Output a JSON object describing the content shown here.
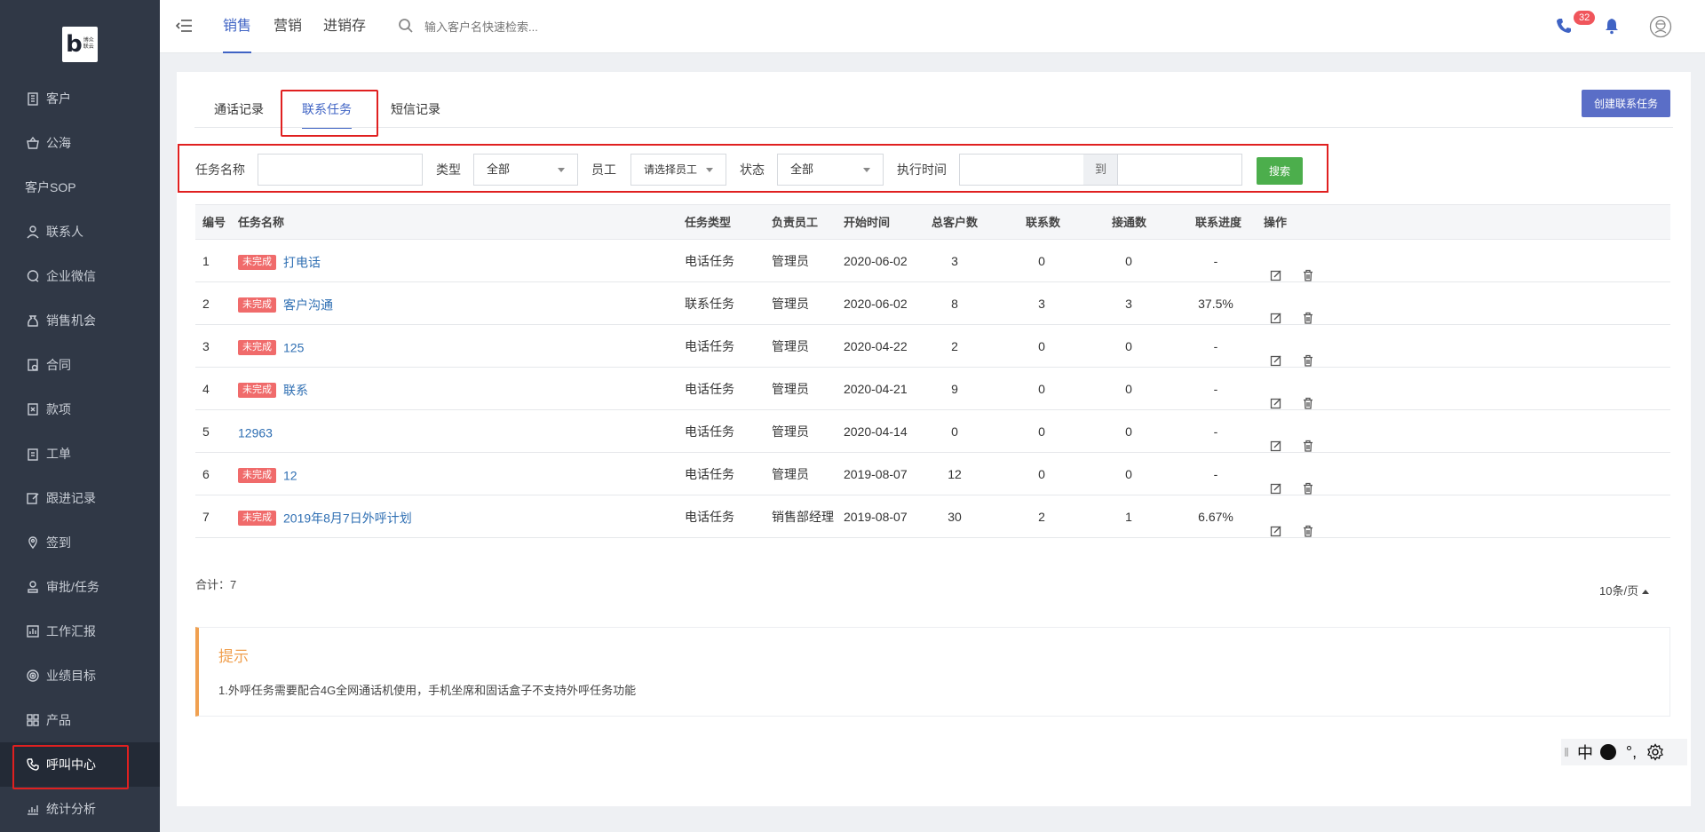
{
  "logo": {
    "letter": "b",
    "text_line1": "博众",
    "text_line2": "联云"
  },
  "sidebar": {
    "items": [
      {
        "label": "客户",
        "icon": "building-icon"
      },
      {
        "label": "公海",
        "icon": "basket-icon"
      },
      {
        "label": "客户SOP",
        "icon": "sop-icon",
        "prefix": "SOP"
      },
      {
        "label": "联系人",
        "icon": "person-icon"
      },
      {
        "label": "企业微信",
        "icon": "chat-icon"
      },
      {
        "label": "销售机会",
        "icon": "moneybag-icon"
      },
      {
        "label": "合同",
        "icon": "contract-icon"
      },
      {
        "label": "款项",
        "icon": "payment-icon"
      },
      {
        "label": "工单",
        "icon": "clipboard-icon"
      },
      {
        "label": "跟进记录",
        "icon": "edit-icon"
      },
      {
        "label": "签到",
        "icon": "location-icon"
      },
      {
        "label": "审批/任务",
        "icon": "approval-icon"
      },
      {
        "label": "工作汇报",
        "icon": "report-icon"
      },
      {
        "label": "业绩目标",
        "icon": "target-icon"
      },
      {
        "label": "产品",
        "icon": "grid-icon"
      },
      {
        "label": "呼叫中心",
        "icon": "phone-icon",
        "active": true
      },
      {
        "label": "统计分析",
        "icon": "chart-icon"
      }
    ]
  },
  "header": {
    "tabs": [
      "销售",
      "营销",
      "进销存"
    ],
    "active_tab": "销售",
    "search_placeholder": "输入客户名快速检索...",
    "notification_count": "32"
  },
  "subtabs": [
    "通话记录",
    "联系任务",
    "短信记录"
  ],
  "active_subtab": "联系任务",
  "create_button": "创建联系任务",
  "filters": {
    "task_name_label": "任务名称",
    "task_name_value": "",
    "type_label": "类型",
    "type_value": "全部",
    "employee_label": "员工",
    "employee_value": "请选择员工",
    "status_label": "状态",
    "status_value": "全部",
    "time_label": "执行时间",
    "time_sep": "到",
    "search_button": "搜索"
  },
  "table": {
    "columns": [
      "编号",
      "任务名称",
      "任务类型",
      "负责员工",
      "开始时间",
      "总客户数",
      "联系数",
      "接通数",
      "联系进度",
      "操作"
    ],
    "status_label": "未完成",
    "rows": [
      {
        "no": "1",
        "status": "未完成",
        "name": "打电话",
        "type": "电话任务",
        "owner": "管理员",
        "start": "2020-06-02",
        "total": "3",
        "contacted": "0",
        "connected": "0",
        "progress": "-"
      },
      {
        "no": "2",
        "status": "未完成",
        "name": "客户沟通",
        "type": "联系任务",
        "owner": "管理员",
        "start": "2020-06-02",
        "total": "8",
        "contacted": "3",
        "connected": "3",
        "progress": "37.5%"
      },
      {
        "no": "3",
        "status": "未完成",
        "name": "125",
        "type": "电话任务",
        "owner": "管理员",
        "start": "2020-04-22",
        "total": "2",
        "contacted": "0",
        "connected": "0",
        "progress": "-"
      },
      {
        "no": "4",
        "status": "未完成",
        "name": "联系",
        "type": "电话任务",
        "owner": "管理员",
        "start": "2020-04-21",
        "total": "9",
        "contacted": "0",
        "connected": "0",
        "progress": "-"
      },
      {
        "no": "5",
        "status": "",
        "name": "12963",
        "type": "电话任务",
        "owner": "管理员",
        "start": "2020-04-14",
        "total": "0",
        "contacted": "0",
        "connected": "0",
        "progress": "-"
      },
      {
        "no": "6",
        "status": "未完成",
        "name": "12",
        "type": "电话任务",
        "owner": "管理员",
        "start": "2019-08-07",
        "total": "12",
        "contacted": "0",
        "connected": "0",
        "progress": "-"
      },
      {
        "no": "7",
        "status": "未完成",
        "name": "2019年8月7日外呼计划",
        "type": "电话任务",
        "owner": "销售部经理",
        "start": "2019-08-07",
        "total": "30",
        "contacted": "2",
        "connected": "1",
        "progress": "6.67%"
      }
    ]
  },
  "footer": {
    "total": "合计：7",
    "per_page": "10条/页"
  },
  "tip": {
    "title": "提示",
    "text": "1.外呼任务需要配合4G全网通话机使用，手机坐席和固话盒子不支持外呼任务功能"
  },
  "ime": {
    "mode": "中",
    "punct": "°,"
  },
  "colors": {
    "sidebar_bg": "#303846",
    "accent": "#3f63c4",
    "status_red": "#f06b6b",
    "link": "#2f6fb3",
    "search_green": "#4cae4c",
    "tip_orange": "#f0a050"
  }
}
